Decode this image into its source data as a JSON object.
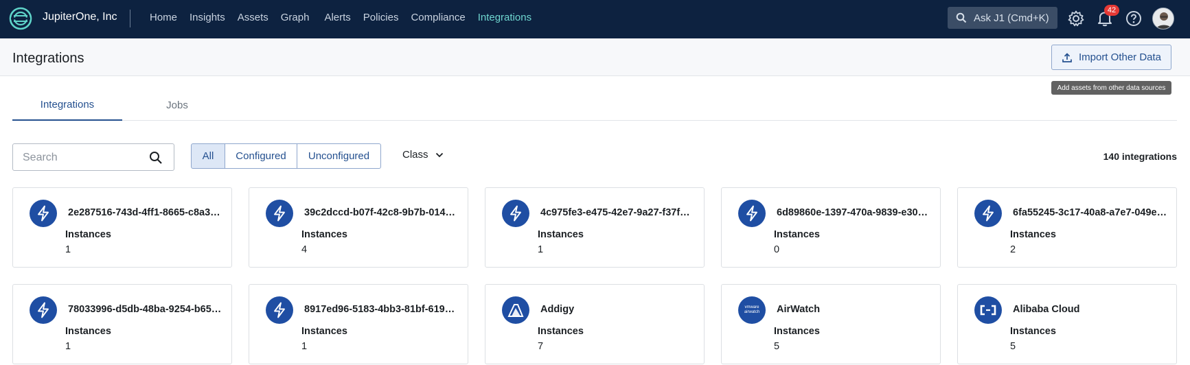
{
  "topbar": {
    "org_name": "JupiterOne, Inc",
    "nav": [
      "Home",
      "Insights",
      "Assets",
      "Graph",
      "Alerts",
      "Policies",
      "Compliance",
      "Integrations"
    ],
    "active_nav": "Integrations",
    "ask_label": "Ask J1 (Cmd+K)",
    "notification_count": "42",
    "icons": [
      "jupiterone-logo-icon",
      "search-icon",
      "gear-icon",
      "bell-icon",
      "help-icon"
    ]
  },
  "page": {
    "title": "Integrations",
    "import_button": "Import Other Data",
    "import_tooltip": "Add assets from other data sources"
  },
  "tabs": [
    "Integrations",
    "Jobs"
  ],
  "filters": {
    "search_placeholder": "Search",
    "segments": [
      "All",
      "Configured",
      "Unconfigured"
    ],
    "selected_segment": "All",
    "class_label": "Class",
    "count_label": "140 integrations"
  },
  "cards": [
    {
      "name": "2e287516-743d-4ff1-8665-c8a3…",
      "instances_label": "Instances",
      "instances": "1",
      "icon": "lightning-icon"
    },
    {
      "name": "39c2dccd-b07f-42c8-9b7b-014e…",
      "instances_label": "Instances",
      "instances": "4",
      "icon": "lightning-icon"
    },
    {
      "name": "4c975fe3-e475-42e7-9a27-f37f…",
      "instances_label": "Instances",
      "instances": "1",
      "icon": "lightning-icon"
    },
    {
      "name": "6d89860e-1397-470a-9839-e30…",
      "instances_label": "Instances",
      "instances": "0",
      "icon": "lightning-icon"
    },
    {
      "name": "6fa55245-3c17-40a8-a7e7-049e…",
      "instances_label": "Instances",
      "instances": "2",
      "icon": "lightning-icon"
    },
    {
      "name": "78033996-d5db-48ba-9254-b65…",
      "instances_label": "Instances",
      "instances": "1",
      "icon": "lightning-icon"
    },
    {
      "name": "8917ed96-5183-4bb3-81bf-619…",
      "instances_label": "Instances",
      "instances": "1",
      "icon": "lightning-icon"
    },
    {
      "name": "Addigy",
      "instances_label": "Instances",
      "instances": "7",
      "icon": "addigy-logo-icon"
    },
    {
      "name": "AirWatch",
      "instances_label": "Instances",
      "instances": "5",
      "icon": "airwatch-logo-icon",
      "icon_text": [
        "vmware",
        "airwatch"
      ]
    },
    {
      "name": "Alibaba Cloud",
      "instances_label": "Instances",
      "instances": "5",
      "icon": "alibaba-cloud-logo-icon"
    }
  ],
  "colors": {
    "topbar_bg": "#0d2240",
    "active_nav": "#6fd7d0",
    "accent": "#24508f",
    "icon_bg": "#1f4ea3",
    "badge": "#e53935"
  }
}
